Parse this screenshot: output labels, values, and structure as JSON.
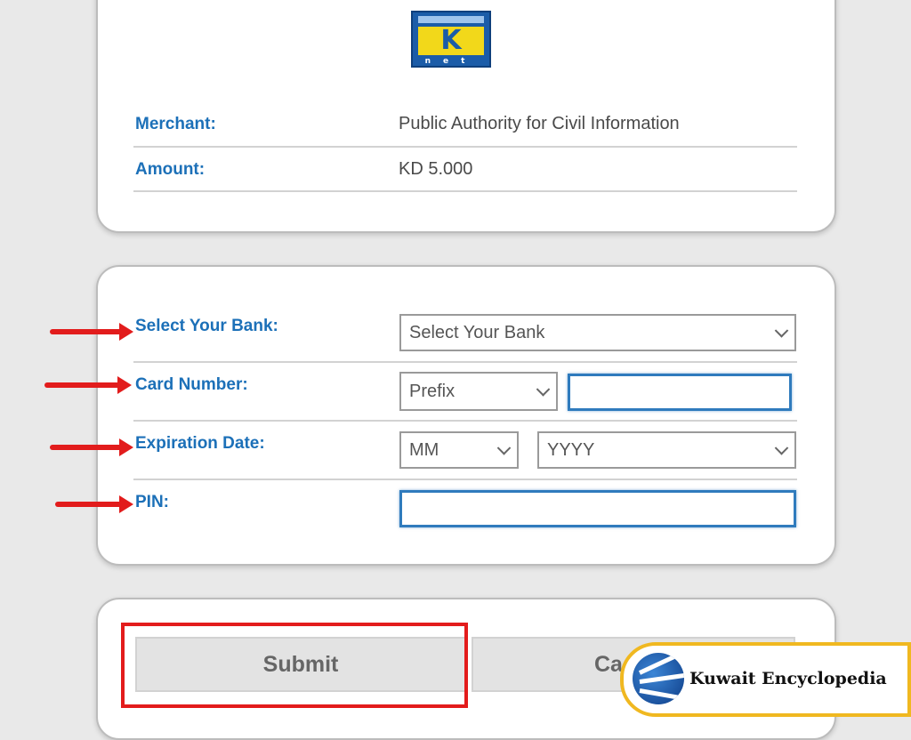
{
  "logo": {
    "text": "K",
    "subtext": "net"
  },
  "payment_info": {
    "merchant_label": "Merchant:",
    "merchant_value": "Public Authority for Civil Information",
    "amount_label": "Amount:",
    "amount_value": "KD 5.000"
  },
  "form": {
    "bank_label": "Select Your Bank:",
    "bank_select_value": "Select Your Bank",
    "card_label": "Card Number:",
    "card_prefix_value": "Prefix",
    "card_number_value": "",
    "expiration_label": "Expiration Date:",
    "exp_month_value": "MM",
    "exp_year_value": "YYYY",
    "pin_label": "PIN:",
    "pin_value": ""
  },
  "actions": {
    "submit_label": "Submit",
    "cancel_label_visible": "Ca"
  },
  "watermark": {
    "text": "Kuwait Encyclopedia"
  },
  "colors": {
    "label_blue": "#1c70b8",
    "annotation_red": "#e21c1c",
    "input_focus_blue": "#2f7bbd",
    "watermark_gold": "#f0b820"
  }
}
